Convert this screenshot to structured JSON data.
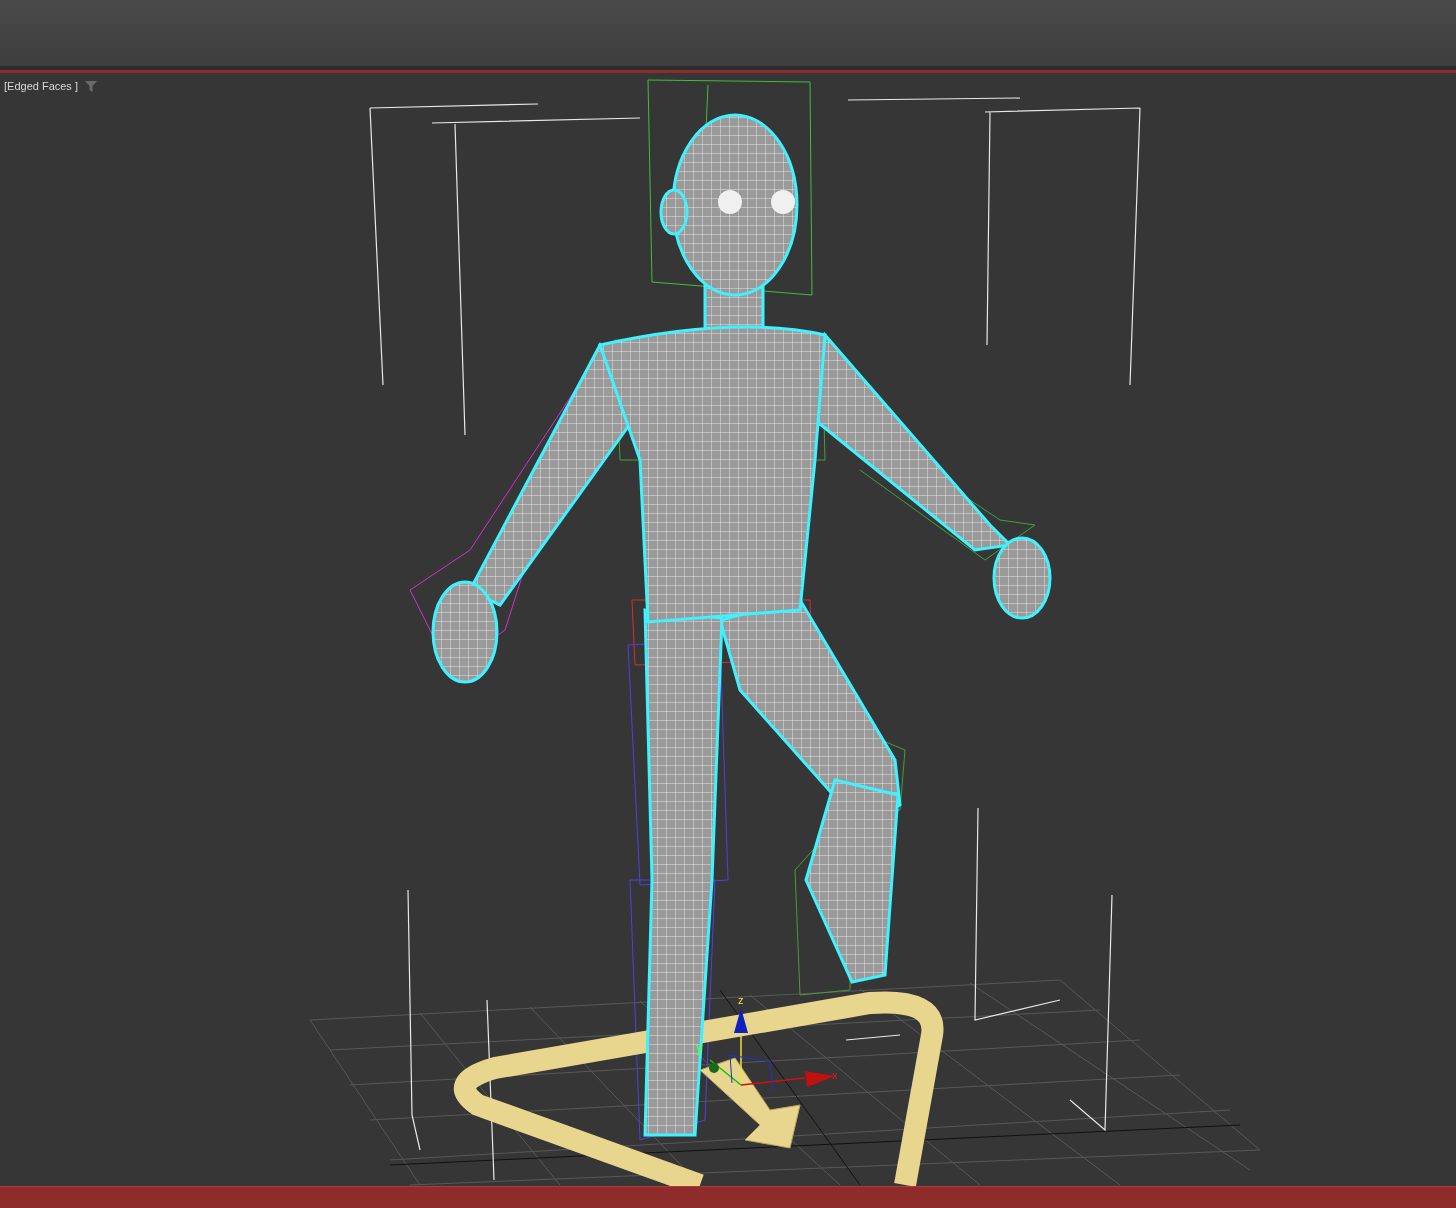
{
  "viewport": {
    "shading_label": "[Edged Faces ]"
  },
  "transform_gizmo": {
    "axis_labels": [
      "z",
      "y",
      "x"
    ]
  }
}
